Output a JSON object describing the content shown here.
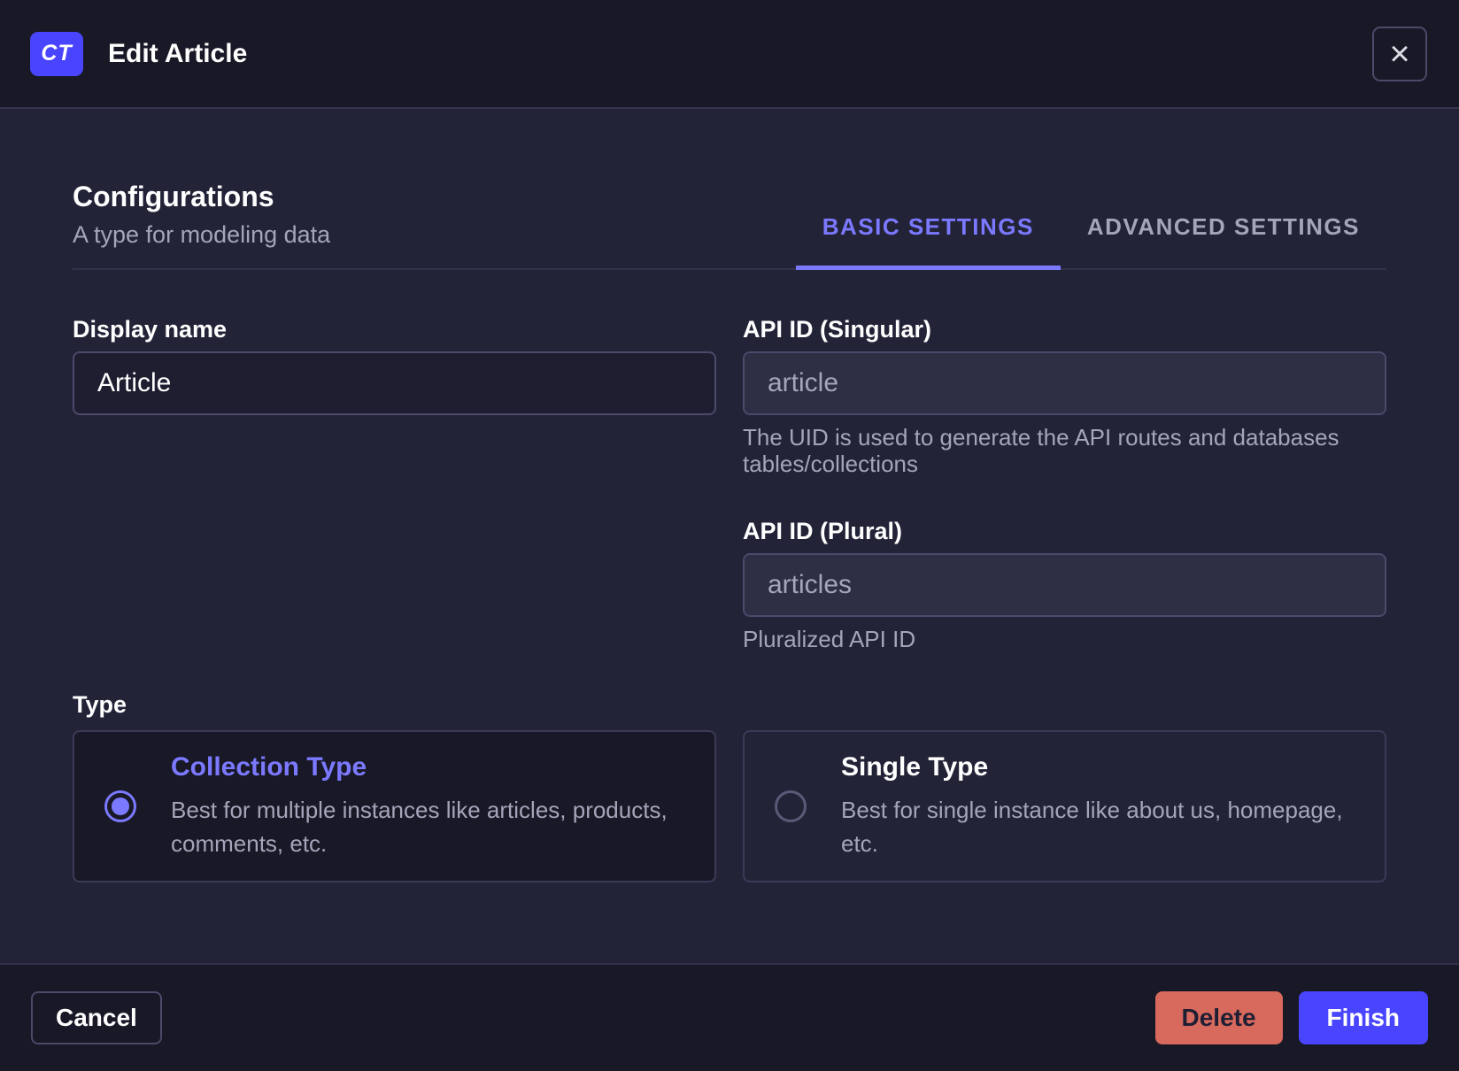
{
  "header": {
    "badge": "CT",
    "title": "Edit Article",
    "close_icon": "×"
  },
  "heading": {
    "title": "Configurations",
    "subtitle": "A type for modeling data"
  },
  "tabs": [
    {
      "label": "BASIC SETTINGS",
      "active": true
    },
    {
      "label": "ADVANCED SETTINGS",
      "active": false
    }
  ],
  "fields": {
    "display_name": {
      "label": "Display name",
      "value": "Article"
    },
    "api_id_singular": {
      "label": "API ID (Singular)",
      "value": "article",
      "hint": "The UID is used to generate the API routes and databases\ntables/collections"
    },
    "api_id_plural": {
      "label": "API ID (Plural)",
      "value": "articles",
      "hint": "Pluralized API ID"
    }
  },
  "type_section": {
    "label": "Type",
    "options": [
      {
        "title": "Collection Type",
        "description": "Best for multiple instances like articles, products,\ncomments, etc.",
        "selected": true
      },
      {
        "title": "Single Type",
        "description": "Best for single instance like about us, homepage,\netc.",
        "selected": false
      }
    ]
  },
  "footer": {
    "cancel_label": "Cancel",
    "delete_label": "Delete",
    "finish_label": "Finish"
  },
  "colors": {
    "primary": "#4945ff",
    "primary_light": "#7b79ff",
    "danger": "#d8695d",
    "header_bg": "#181826",
    "body_bg": "#232338",
    "text_muted": "#a5a5ba"
  }
}
